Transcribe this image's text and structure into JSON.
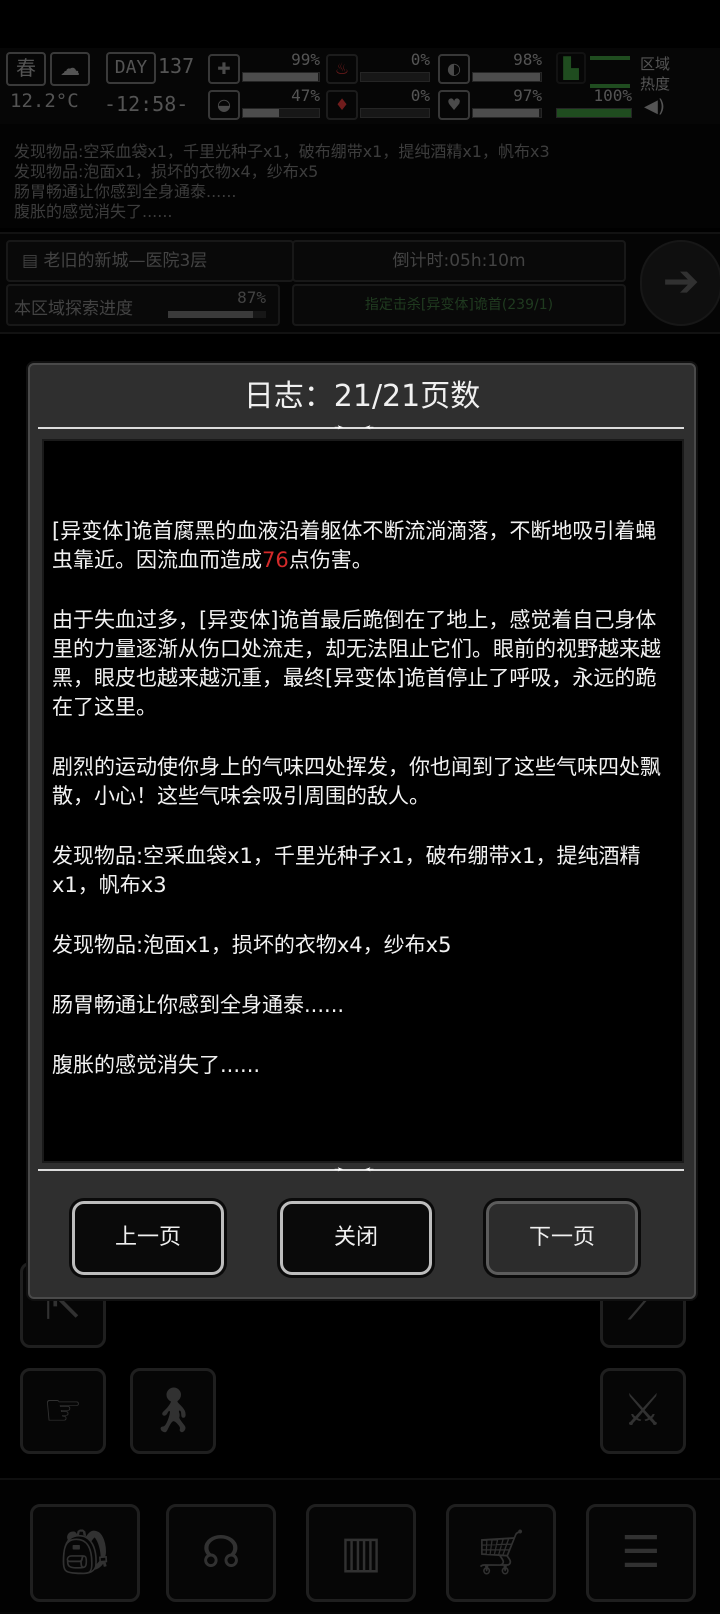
{
  "status": {
    "season": "春",
    "temperature": "12.2°C",
    "day_label": "DAY",
    "day_number": "137",
    "clock": "-12:58-",
    "stats": [
      {
        "icon": "medkit-icon",
        "glyph": "✚",
        "value": "99%",
        "fill": 0.99
      },
      {
        "icon": "stomach-icon",
        "glyph": "♨",
        "value": "0%",
        "fill": 0.0
      },
      {
        "icon": "pill-icon",
        "glyph": "◐",
        "value": "98%",
        "fill": 0.98
      },
      {
        "icon": "food-icon",
        "glyph": "◒",
        "value": "47%",
        "fill": 0.47
      },
      {
        "icon": "blood-icon",
        "glyph": "♦",
        "value": "0%",
        "fill": 0.0
      },
      {
        "icon": "heart-icon",
        "glyph": "♥",
        "value": "97%",
        "fill": 0.97
      }
    ],
    "energy_value": "100%",
    "area_label_line1": "区域",
    "area_label_line2": "热度"
  },
  "background_log": [
    "发现物品:空采血袋x1，千里光种子x1，破布绷带x1，提纯酒精x1，帆布x3",
    "发现物品:泡面x1，损坏的衣物x4，纱布x5",
    "肠胃畅通让你感到全身通泰......",
    "腹胀的感觉消失了......"
  ],
  "location": {
    "name": "老旧的新城—医院3层",
    "countdown": "倒计时:05h:10m",
    "progress_label": "本区域探索进度",
    "progress_value": "87%",
    "progress_fill": 0.87,
    "task": "指定击杀[异变体]诡首(239/1)"
  },
  "modal": {
    "title": "日志：21/21页数",
    "entries": [
      {
        "before": "[异变体]诡首腐黑的血液沿着躯体不断流淌滴落，不断地吸引着蝇虫靠近。因流血而造成",
        "damage": "76",
        "after": "点伤害。"
      },
      {
        "before": "由于失血过多，[异变体]诡首最后跪倒在了地上，感觉着自己身体里的力量逐渐从伤口处流走，却无法阻止它们。眼前的视野越来越黑，眼皮也越来越沉重，最终[异变体]诡首停止了呼吸，永远的跪在了这里。"
      },
      {
        "before": "剧烈的运动使你身上的气味四处挥发，你也闻到了这些气味四处飘散，小心！这些气味会吸引周围的敌人。"
      },
      {
        "before": "发现物品:空采血袋x1，千里光种子x1，破布绷带x1，提纯酒精x1，帆布x3"
      },
      {
        "before": "发现物品:泡面x1，损坏的衣物x4，纱布x5"
      },
      {
        "before": "肠胃畅通让你感到全身通泰......"
      },
      {
        "before": "腹胀的感觉消失了......"
      }
    ],
    "prev_label": "上一页",
    "close_label": "关闭",
    "next_label": "下一页"
  },
  "colors": {
    "damage": "#d42a2a",
    "modal_bg": "#2f2f2f"
  }
}
